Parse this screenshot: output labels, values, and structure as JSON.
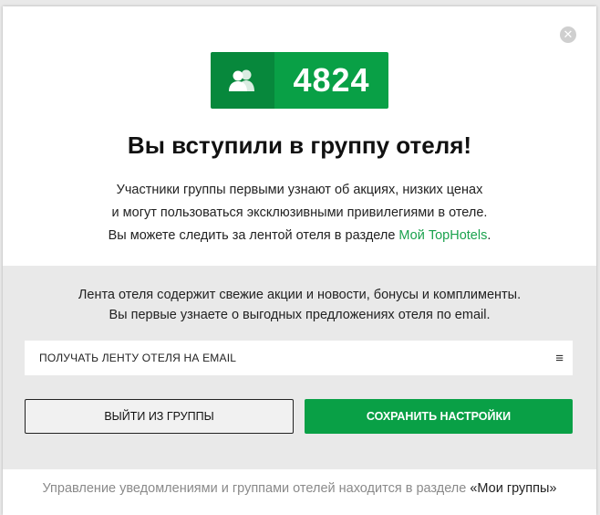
{
  "modal": {
    "close_symbol": "✕",
    "counter": {
      "icon": "group-users-icon",
      "value": "4824"
    },
    "title": "Вы вступили в группу отеля!",
    "description": {
      "line1": "Участники группы первыми узнают об акциях, низких ценах",
      "line2": "и могут пользоваться эксклюзивными привилегиями в отеле.",
      "line3_prefix": "Вы можете следить за лентой отеля в разделе ",
      "line3_link": "Мой TopHotels",
      "line3_suffix": "."
    },
    "feed": {
      "line1": "Лента отеля содержит свежие акции и новости, бонусы и комплименты.",
      "line2": "Вы первые узнаете о выгодных предложениях отеля по email.",
      "select_value": "ПОЛУЧАТЬ ЛЕНТУ ОТЕЛЯ НА EMAIL",
      "select_icon": "≡"
    },
    "buttons": {
      "leave_label": "ВЫЙТИ ИЗ ГРУППЫ",
      "save_label": "СОХРАНИТЬ НАСТРОЙКИ"
    },
    "footer": {
      "text": "Управление уведомлениями и группами отелей находится в разделе ",
      "link": "«Мои группы»"
    }
  },
  "colors": {
    "accent_green": "#09a046",
    "accent_green_dark": "#07883c",
    "link_green": "#1ba24e",
    "section_gray": "#e9e9e9"
  }
}
